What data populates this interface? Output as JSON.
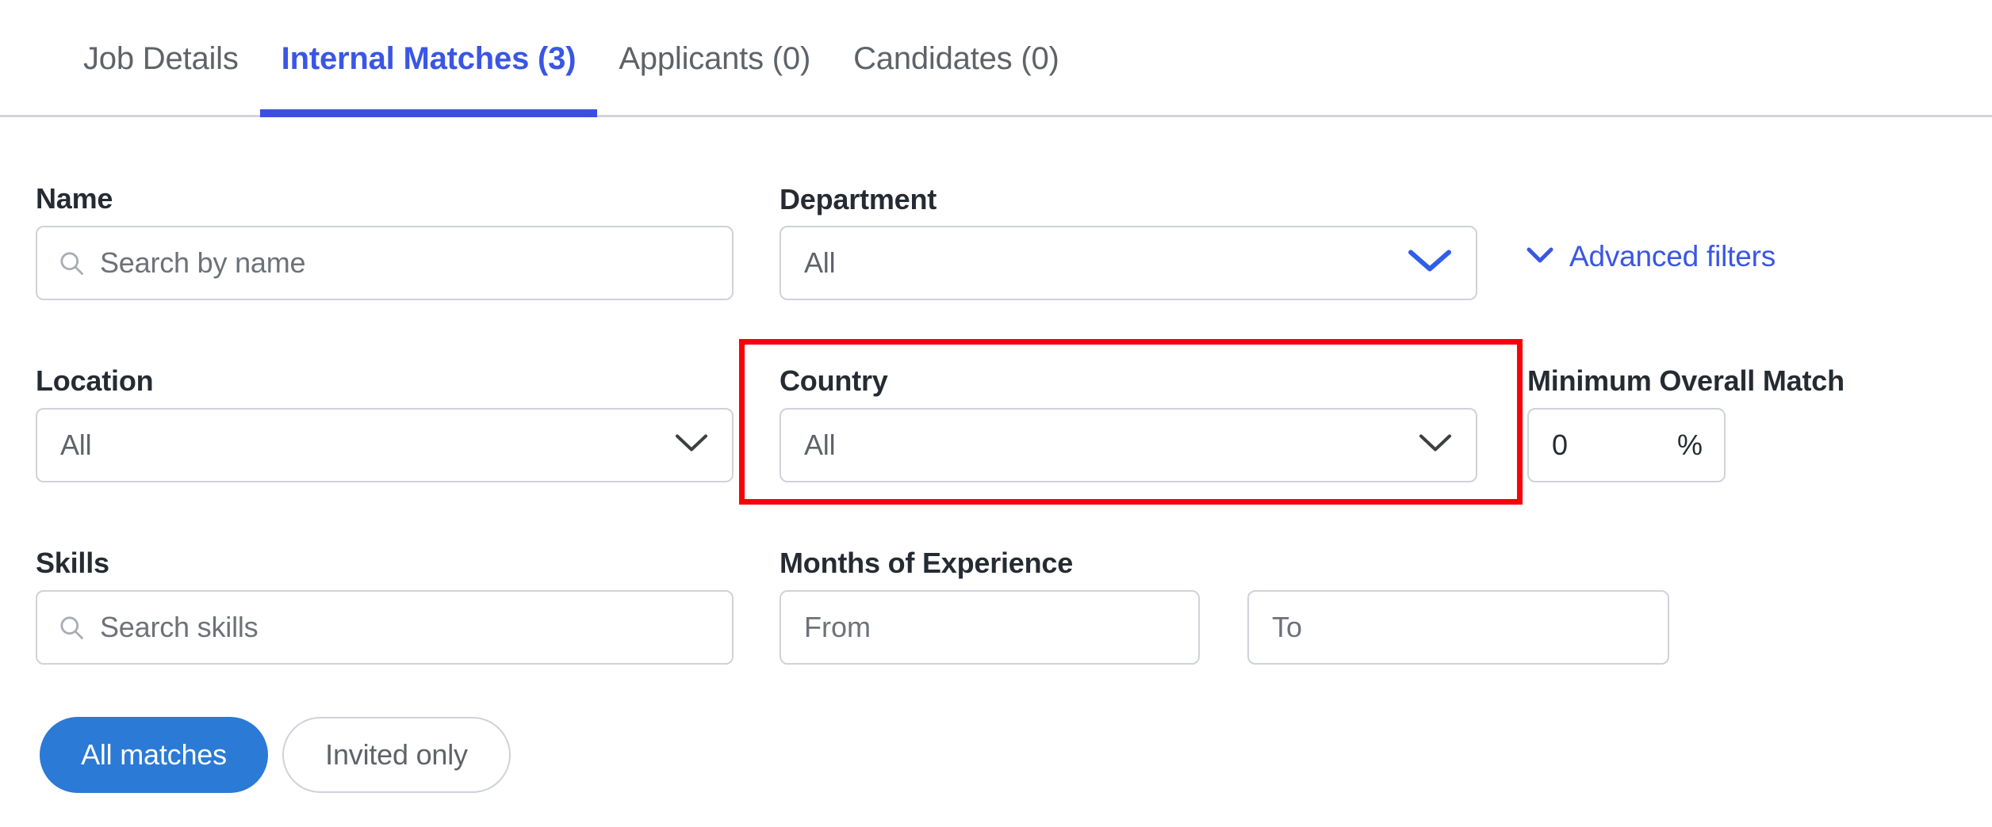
{
  "colors": {
    "tab_active": "#3a56e4",
    "tab_inactive": "#5f6368",
    "tab_underline": "#3a4fe0",
    "link_blue": "#3a56e4",
    "primary_button": "#2b7ad6",
    "highlight_box": "#fb0007",
    "field_border": "#cfd2d8",
    "label_text": "#262b33",
    "placeholder_text": "#6d7178",
    "divider": "#d2d4da"
  },
  "tabs": [
    {
      "label": "Job Details",
      "active": false
    },
    {
      "label": "Internal Matches (3)",
      "active": true
    },
    {
      "label": "Applicants (0)",
      "active": false
    },
    {
      "label": "Candidates (0)",
      "active": false
    }
  ],
  "filters": {
    "name": {
      "label": "Name",
      "placeholder": "Search by name",
      "value": "",
      "icon": "search-icon"
    },
    "department": {
      "label": "Department",
      "value": "All",
      "icon": "chevron-down-icon",
      "chevron_color": "#2f5fe8"
    },
    "advanced_filters": {
      "label": "Advanced filters",
      "icon": "chevron-down-icon"
    },
    "location": {
      "label": "Location",
      "value": "All",
      "icon": "chevron-down-icon",
      "chevron_color": "#3c4043"
    },
    "country": {
      "label": "Country",
      "value": "All",
      "icon": "chevron-down-icon",
      "chevron_color": "#3c4043",
      "highlighted": true
    },
    "minimum_overall_match": {
      "label": "Minimum Overall Match",
      "value": "0",
      "unit": "%"
    },
    "skills": {
      "label": "Skills",
      "placeholder": "Search skills",
      "value": "",
      "icon": "search-icon"
    },
    "months_of_experience": {
      "label": "Months of Experience",
      "from_placeholder": "From",
      "from_value": "",
      "to_placeholder": "To",
      "to_value": ""
    }
  },
  "toggles": [
    {
      "label": "All matches",
      "selected": true
    },
    {
      "label": "Invited only",
      "selected": false
    }
  ]
}
